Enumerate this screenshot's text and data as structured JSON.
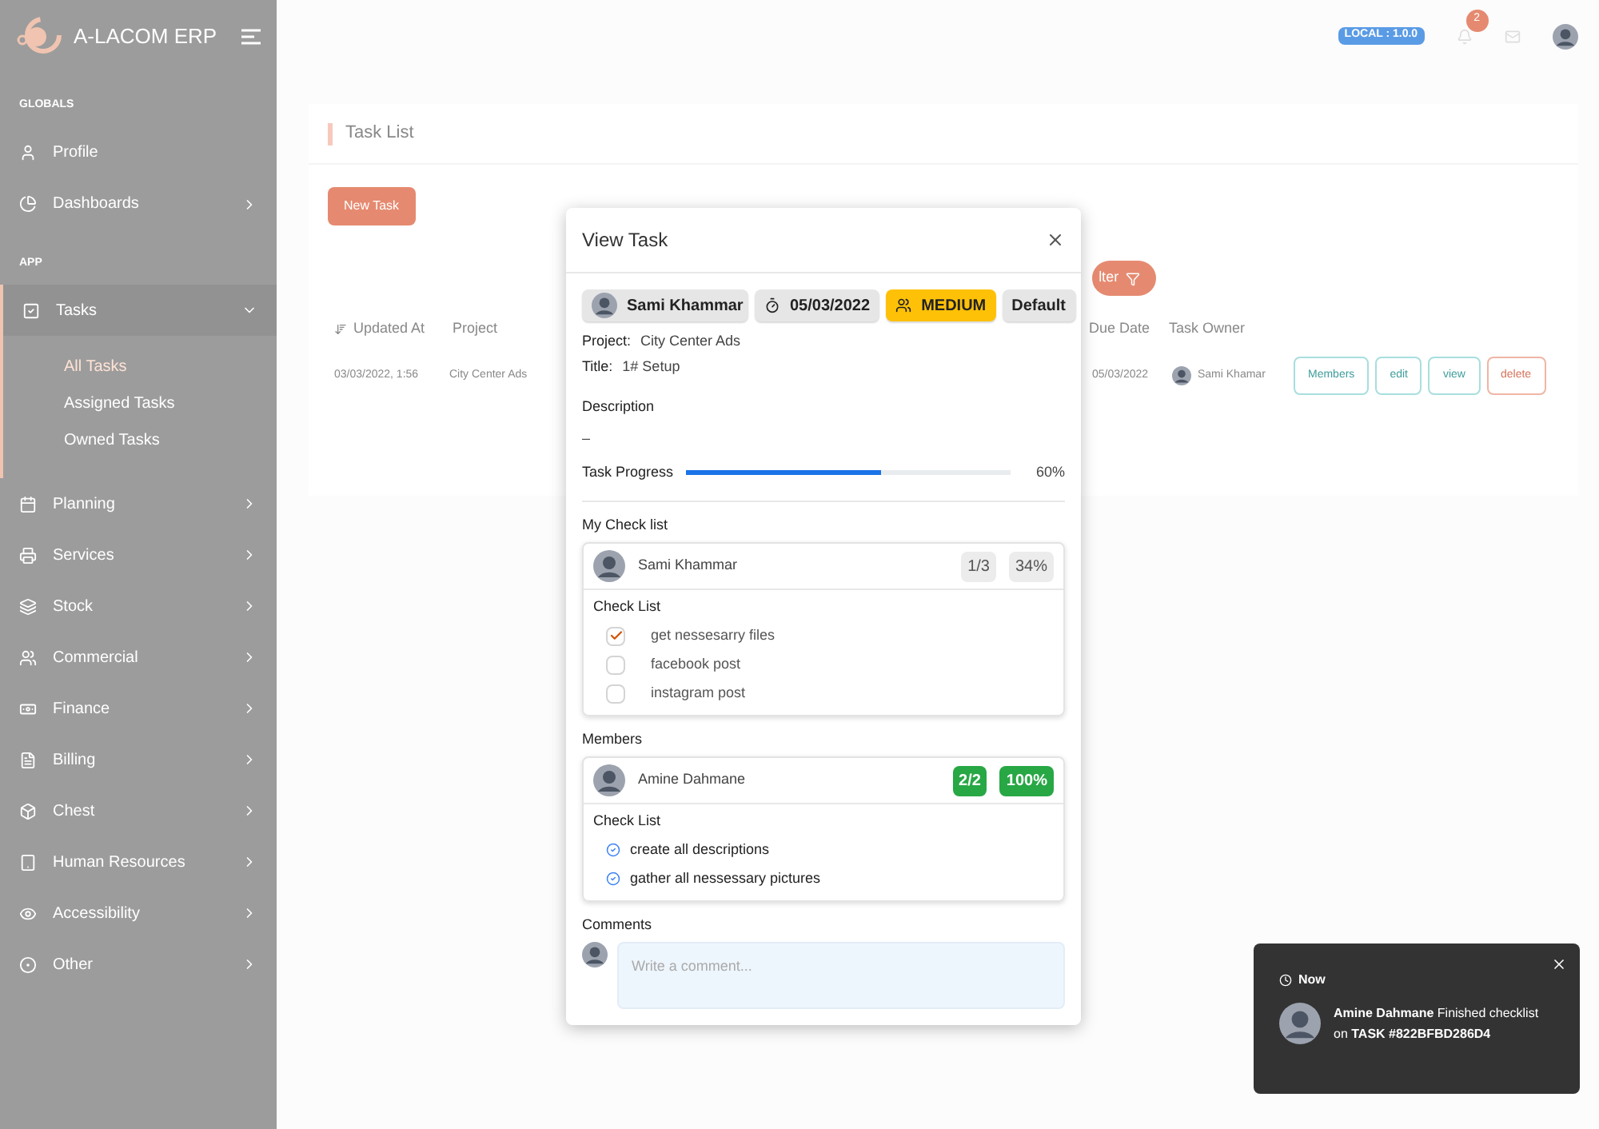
{
  "brand": {
    "name": "A-LACOM ERP"
  },
  "topbar": {
    "version_badge": "LOCAL : 1.0.0",
    "notification_count": "2"
  },
  "sidebar": {
    "sections": [
      {
        "heading": "GLOBALS",
        "items": [
          {
            "label": "Profile",
            "has_arrow": false,
            "expanded": false
          },
          {
            "label": "Dashboards",
            "has_arrow": true,
            "expanded": false
          }
        ]
      },
      {
        "heading": "APP",
        "items": [
          {
            "label": "Tasks",
            "has_arrow": true,
            "expanded": true,
            "children": [
              {
                "label": "All Tasks",
                "selected": true
              },
              {
                "label": "Assigned Tasks",
                "selected": false
              },
              {
                "label": "Owned Tasks",
                "selected": false
              }
            ]
          },
          {
            "label": "Planning",
            "has_arrow": true,
            "expanded": false
          },
          {
            "label": "Services",
            "has_arrow": true,
            "expanded": false
          },
          {
            "label": "Stock",
            "has_arrow": true,
            "expanded": false
          },
          {
            "label": "Commercial",
            "has_arrow": true,
            "expanded": false
          },
          {
            "label": "Finance",
            "has_arrow": true,
            "expanded": false
          },
          {
            "label": "Billing",
            "has_arrow": true,
            "expanded": false
          },
          {
            "label": "Chest",
            "has_arrow": true,
            "expanded": false
          },
          {
            "label": "Human Resources",
            "has_arrow": true,
            "expanded": false
          },
          {
            "label": "Accessibility",
            "has_arrow": true,
            "expanded": false
          },
          {
            "label": "Other",
            "has_arrow": true,
            "expanded": false
          }
        ]
      }
    ]
  },
  "page": {
    "title": "Task List",
    "new_button": "New Task",
    "filter_button": "lter",
    "table": {
      "columns": [
        "Updated At",
        "Project",
        "Due Date",
        "Task Owner"
      ],
      "rows": [
        {
          "updated_at": "03/03/2022, 1:56",
          "project": "City Center Ads",
          "due_date": "05/03/2022",
          "owner": "Sami Khamar",
          "actions": [
            "Members",
            "edit",
            "view",
            "delete"
          ]
        }
      ]
    }
  },
  "modal": {
    "title": "View Task",
    "tags": [
      {
        "kind": "person",
        "label": "Sami Khammar"
      },
      {
        "kind": "date",
        "label": "05/03/2022"
      },
      {
        "kind": "priority",
        "label": "MEDIUM"
      },
      {
        "kind": "plain",
        "label": "Default"
      }
    ],
    "fields": [
      {
        "label": "Project:",
        "value": "City Center Ads"
      },
      {
        "label": "Title:",
        "value": "1# Setup"
      }
    ],
    "description": {
      "label": "Description",
      "value": "–"
    },
    "progress": {
      "label": "Task Progress",
      "level": 0.6,
      "reading": "60%"
    },
    "my_checklist": {
      "heading": "My Check list",
      "cards": [
        {
          "name": "Sami Khammar",
          "count": "1/3",
          "percent": "34%",
          "complete": false,
          "list_label": "Check List",
          "items": [
            {
              "label": "get nessesarry files",
              "checked": true
            },
            {
              "label": "facebook post",
              "checked": false
            },
            {
              "label": "instagram post",
              "checked": false
            }
          ]
        }
      ]
    },
    "members": {
      "heading": "Members",
      "cards": [
        {
          "name": "Amine Dahmane",
          "count": "2/2",
          "percent": "100%",
          "complete": true,
          "list_label": "Check List",
          "items": [
            {
              "label": "create all descriptions",
              "checked": true
            },
            {
              "label": "gather all nessessary pictures",
              "checked": true
            }
          ]
        }
      ]
    },
    "comments": {
      "heading": "Comments",
      "placeholder": "Write a comment..."
    }
  },
  "toast": {
    "time": "Now",
    "message": "**Amine Dahmane** Finished checklist on **TASK #822BFBD286D4**"
  }
}
